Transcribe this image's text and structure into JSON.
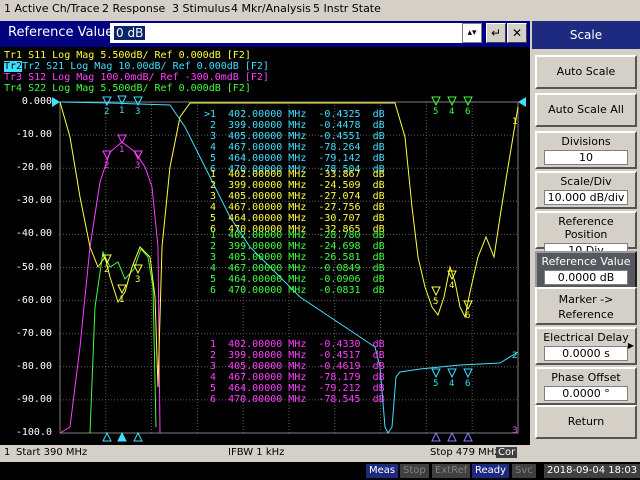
{
  "menu": [
    "1 Active Ch/Trace",
    "2 Response",
    "3 Stimulus",
    "4 Mkr/Analysis",
    "5 Instr State"
  ],
  "entry": {
    "label": "Reference Value",
    "value": "0 dB",
    "buttons": [
      "↵",
      "✕"
    ]
  },
  "panel": {
    "title": "Scale",
    "keys": [
      {
        "label": "Auto Scale"
      },
      {
        "label": "Auto Scale All"
      },
      {
        "label": "Divisions",
        "value": "10"
      },
      {
        "label": "Scale/Div",
        "value": "10.000 dB/div"
      },
      {
        "label": "Reference Position",
        "value": "10 Div"
      },
      {
        "label": "Reference Value",
        "value": "0.0000 dB",
        "selected": true
      },
      {
        "label": "Marker -> Reference"
      },
      {
        "label": "Electrical Delay",
        "value": "0.0000 s"
      },
      {
        "label": "Phase Offset",
        "value": "0.0000 °"
      },
      {
        "label": "Return"
      }
    ]
  },
  "traces": [
    {
      "id": "Tr1",
      "text": "Tr1 S11 Log Mag 5.500dB/ Ref 0.000dB [F2]",
      "color": "#ffff40"
    },
    {
      "id": "Tr2",
      "text": "Tr2 S21 Log Mag 10.00dB/ Ref 0.000dB [F2]",
      "color": "#40e0ff",
      "active": true
    },
    {
      "id": "Tr3",
      "text": "Tr3 S12 Log Mag 100.0mdB/ Ref -300.0mdB [F2]",
      "color": "#ff40ff"
    },
    {
      "id": "Tr4",
      "text": "Tr4 S22 Log Mag 5.500dB/ Ref 0.000dB [F2]",
      "color": "#40ff40"
    }
  ],
  "y_axis": [
    "0.000",
    "-10.00",
    "-20.00",
    "-30.00",
    "-40.00",
    "-50.00",
    "-60.00",
    "-70.00",
    "-80.00",
    "-90.00",
    "-100.0"
  ],
  "marker_tables": [
    {
      "trace": "Tr2",
      "color": "#40e0ff",
      "rows": [
        [
          ">1",
          "402.00000 MHz",
          "-0.4325",
          "dB"
        ],
        [
          "2",
          "399.00000 MHz",
          "-0.4478",
          "dB"
        ],
        [
          "3",
          "405.00000 MHz",
          "-0.4551",
          "dB"
        ],
        [
          "4",
          "467.00000 MHz",
          "-78.264",
          "dB"
        ],
        [
          "5",
          "464.00000 MHz",
          "-79.142",
          "dB"
        ],
        [
          "6",
          "470.00000 MHz",
          "-78.504",
          "dB"
        ]
      ]
    },
    {
      "trace": "Tr1",
      "color": "#ffff40",
      "rows": [
        [
          "1",
          "402.00000 MHz",
          "-33.867",
          "dB"
        ],
        [
          "2",
          "399.00000 MHz",
          "-24.509",
          "dB"
        ],
        [
          "3",
          "405.00000 MHz",
          "-27.074",
          "dB"
        ],
        [
          "4",
          "467.00000 MHz",
          "-27.756",
          "dB"
        ],
        [
          "5",
          "464.00000 MHz",
          "-30.707",
          "dB"
        ],
        [
          "6",
          "470.00000 MHz",
          "-32.865",
          "dB"
        ]
      ]
    },
    {
      "trace": "Tr4",
      "color": "#40ff40",
      "rows": [
        [
          "1",
          "402.00000 MHz",
          "-28.780",
          "dB"
        ],
        [
          "2",
          "399.00000 MHz",
          "-24.698",
          "dB"
        ],
        [
          "3",
          "405.00000 MHz",
          "-26.581",
          "dB"
        ],
        [
          "4",
          "467.00000 MHz",
          "-0.0849",
          "dB"
        ],
        [
          "5",
          "464.00000 MHz",
          "-0.0906",
          "dB"
        ],
        [
          "6",
          "470.00000 MHz",
          "-0.0831",
          "dB"
        ]
      ]
    },
    {
      "trace": "Tr3",
      "color": "#ff40ff",
      "rows": [
        [
          "1",
          "402.00000 MHz",
          "-0.4330",
          "dB"
        ],
        [
          "2",
          "399.00000 MHz",
          "-0.4517",
          "dB"
        ],
        [
          "3",
          "405.00000 MHz",
          "-0.4619",
          "dB"
        ],
        [
          "4",
          "467.00000 MHz",
          "-78.179",
          "dB"
        ],
        [
          "5",
          "464.00000 MHz",
          "-79.212",
          "dB"
        ],
        [
          "6",
          "470.00000 MHz",
          "-78.545",
          "dB"
        ]
      ]
    }
  ],
  "footer": {
    "ch": "1",
    "start": "Start 390 MHz",
    "ifbw": "IFBW 1 kHz",
    "stop": "Stop 479 MHz",
    "cor": "Cor"
  },
  "status": {
    "meas": "Meas",
    "stop": "Stop",
    "extref": "ExtRef",
    "ready": "Ready",
    "svc": "Svc",
    "datetime": "2018-09-04 18:03"
  }
}
